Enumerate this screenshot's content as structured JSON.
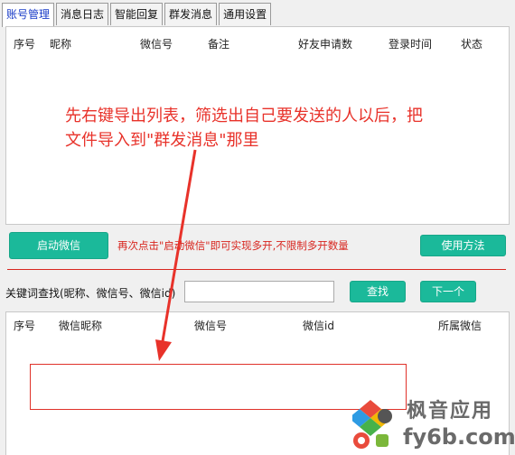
{
  "tabs": [
    "账号管理",
    "消息日志",
    "智能回复",
    "群发消息",
    "通用设置"
  ],
  "account_table": {
    "columns": [
      "序号",
      "昵称",
      "微信号",
      "备注",
      "好友申请数",
      "登录时间",
      "状态"
    ]
  },
  "hint_text": {
    "line1": "先右键导出列表，筛选出自己要发送的人以后，把",
    "line2": "文件导入到\"群发消息\"那里"
  },
  "buttons": {
    "start_wechat": "启动微信",
    "usage": "使用方法",
    "search": "查找",
    "next": "下一个"
  },
  "multi_open_note": "再次点击\"启动微信\"即可实现多开,不限制多开数量",
  "search": {
    "label": "关键词查找(昵称、微信号、微信id)",
    "value": ""
  },
  "result_table": {
    "columns": [
      "序号",
      "微信昵称",
      "微信号",
      "微信id",
      "所属微信"
    ]
  },
  "watermark": {
    "line1": "枫音应用",
    "line2": "fy6b.com"
  },
  "colors": {
    "accent_green": "#1bb99a",
    "annotation_red": "#e8322a",
    "active_tab_text": "#1a3cc8"
  }
}
